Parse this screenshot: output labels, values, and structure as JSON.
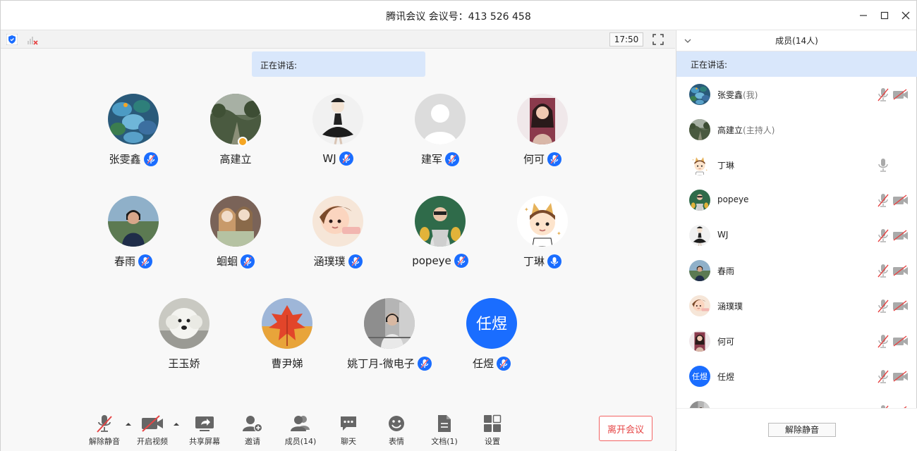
{
  "window": {
    "title": "腾讯会议 会议号：413 526 458"
  },
  "toolbar": {
    "time": "17:50"
  },
  "speaking_label": "正在讲话:",
  "tiles": [
    {
      "name": "张雯鑫",
      "mic": true,
      "avatar": "stones"
    },
    {
      "name": "高建立",
      "mic": false,
      "host": true,
      "avatar": "forest"
    },
    {
      "name": "WJ",
      "mic": true,
      "avatar": "ballerina"
    },
    {
      "name": "建军",
      "mic": true,
      "avatar": "default"
    },
    {
      "name": "何可",
      "mic": true,
      "avatar": "woman"
    },
    {
      "name": "春雨",
      "mic": true,
      "avatar": "girl-lake"
    },
    {
      "name": "蛔蛔",
      "mic": true,
      "avatar": "dolls"
    },
    {
      "name": "涵璞璞",
      "mic": true,
      "avatar": "cartoon-girl"
    },
    {
      "name": "popeye",
      "mic": true,
      "avatar": "pineapple"
    },
    {
      "name": "丁琳",
      "mic": true,
      "active": true,
      "avatar": "cartoon-cat"
    },
    {
      "name": "王玉娇",
      "mic": false,
      "avatar": "dog"
    },
    {
      "name": "曹尹娣",
      "mic": false,
      "avatar": "leaf"
    },
    {
      "name": "姚丁月-微电子",
      "mic": true,
      "avatar": "street"
    },
    {
      "name": "任煜",
      "mic": true,
      "avatar": "text",
      "avatar_text": "任煜"
    }
  ],
  "controls": {
    "mute": "解除静音",
    "video": "开启视频",
    "share": "共享屏幕",
    "invite": "邀请",
    "members": "成员(14)",
    "chat": "聊天",
    "emoji": "表情",
    "docs": "文档(1)",
    "settings": "设置",
    "leave": "离开会议"
  },
  "sidebar": {
    "header": "成员(14人)",
    "speaking": "正在讲话:",
    "unmute_all": "解除静音",
    "members": [
      {
        "name": "张雯鑫",
        "role": "(我)",
        "avatar": "stones",
        "mic": "muted",
        "cam": "off"
      },
      {
        "name": "高建立",
        "role": "(主持人)",
        "avatar": "forest",
        "mic": "none",
        "cam": "none"
      },
      {
        "name": "丁琳",
        "role": "",
        "avatar": "cartoon-cat",
        "mic": "on",
        "cam": "none"
      },
      {
        "name": "popeye",
        "role": "",
        "avatar": "pineapple",
        "mic": "muted",
        "cam": "off"
      },
      {
        "name": "WJ",
        "role": "",
        "avatar": "ballerina",
        "mic": "muted",
        "cam": "off"
      },
      {
        "name": "春雨",
        "role": "",
        "avatar": "girl-lake",
        "mic": "muted",
        "cam": "off"
      },
      {
        "name": "涵璞璞",
        "role": "",
        "avatar": "cartoon-girl",
        "mic": "muted",
        "cam": "off"
      },
      {
        "name": "何可",
        "role": "",
        "avatar": "woman",
        "mic": "muted",
        "cam": "off"
      },
      {
        "name": "任煜",
        "role": "",
        "avatar": "text",
        "avatar_text": "任煜",
        "mic": "muted",
        "cam": "off"
      },
      {
        "name": "",
        "role": "",
        "avatar": "street",
        "mic": "muted",
        "cam": "off"
      }
    ]
  },
  "colors": {
    "accent": "#1a6dff",
    "speaking_bg": "#d9e7fb",
    "leave": "#e64545",
    "mute_red": "#e64545"
  }
}
